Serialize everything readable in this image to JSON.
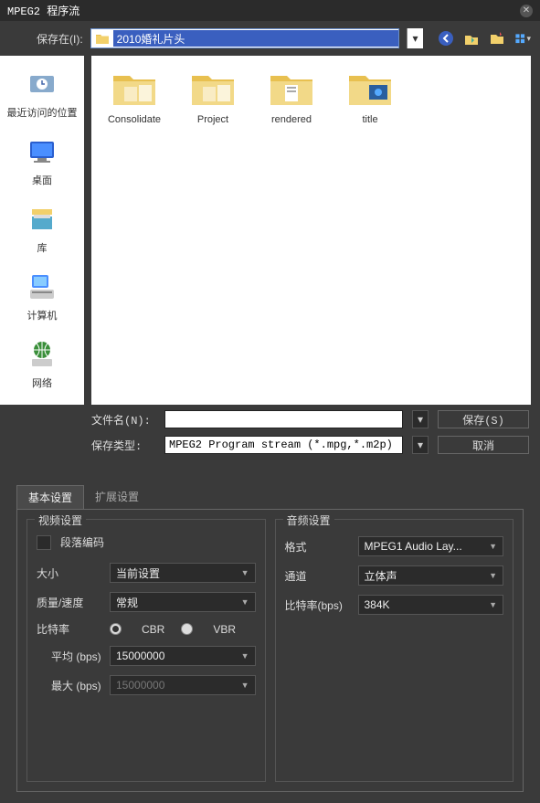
{
  "title": "MPEG2 程序流",
  "location": {
    "label": "保存在(I):",
    "value": "2010婚礼片头"
  },
  "toolbar_icons": [
    "back",
    "up",
    "new-folder",
    "view"
  ],
  "sidebar": {
    "items": [
      {
        "label": "最近访问的位置",
        "icon": "recent"
      },
      {
        "label": "桌面",
        "icon": "desktop"
      },
      {
        "label": "库",
        "icon": "library"
      },
      {
        "label": "计算机",
        "icon": "computer"
      },
      {
        "label": "网络",
        "icon": "network"
      }
    ]
  },
  "folders": [
    {
      "name": "Consolidate"
    },
    {
      "name": "Project"
    },
    {
      "name": "rendered"
    },
    {
      "name": "title"
    }
  ],
  "file": {
    "name_label": "文件名(N):",
    "name_value": "",
    "type_label": "保存类型:",
    "type_value": "MPEG2 Program stream (*.mpg,*.m2p)",
    "save_btn": "保存(S)",
    "cancel_btn": "取消"
  },
  "tabs": {
    "basic": "基本设置",
    "extended": "扩展设置"
  },
  "video": {
    "title": "视频设置",
    "segment_encode": "段落编码",
    "size_label": "大小",
    "size_value": "当前设置",
    "quality_label": "质量/速度",
    "quality_value": "常规",
    "bitrate_label": "比特率",
    "cbr": "CBR",
    "vbr": "VBR",
    "avg_label": "平均 (bps)",
    "avg_value": "15000000",
    "max_label": "最大 (bps)",
    "max_value": "15000000"
  },
  "audio": {
    "title": "音频设置",
    "format_label": "格式",
    "format_value": "MPEG1 Audio Lay...",
    "channel_label": "通道",
    "channel_value": "立体声",
    "bitrate_label": "比特率(bps)",
    "bitrate_value": "384K"
  }
}
